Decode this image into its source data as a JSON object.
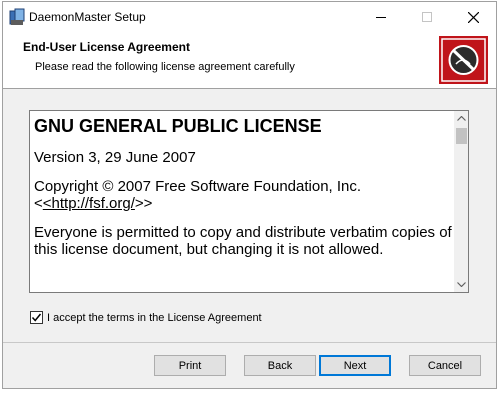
{
  "window": {
    "title": "DaemonMaster Setup",
    "icons": {
      "app": "installer-icon",
      "minimize": "minimize-icon",
      "maximize": "maximize-icon",
      "close": "close-icon"
    }
  },
  "banner": {
    "title": "End-User License Agreement",
    "subtitle": "Please read the following license agreement carefully",
    "logo_icon": "daemonmaster-logo-icon",
    "logo_color": "#c0141a"
  },
  "license": {
    "heading": "GNU GENERAL PUBLIC LICENSE",
    "version": "Version 3, 29 June 2007",
    "copyright": "Copyright © 2007 Free Software Foundation, Inc.",
    "link_prefix": "<",
    "link_text": "<http://fsf.org/",
    "link_suffix": ">>",
    "paragraph": "Everyone is permitted to copy and distribute verbatim copies of this license document, but changing it is not allowed."
  },
  "accept": {
    "label": "I accept the terms in the License Agreement",
    "checked": true
  },
  "buttons": {
    "print": "Print",
    "back": "Back",
    "next": "Next",
    "cancel": "Cancel"
  },
  "colors": {
    "accent": "#0078d7"
  }
}
